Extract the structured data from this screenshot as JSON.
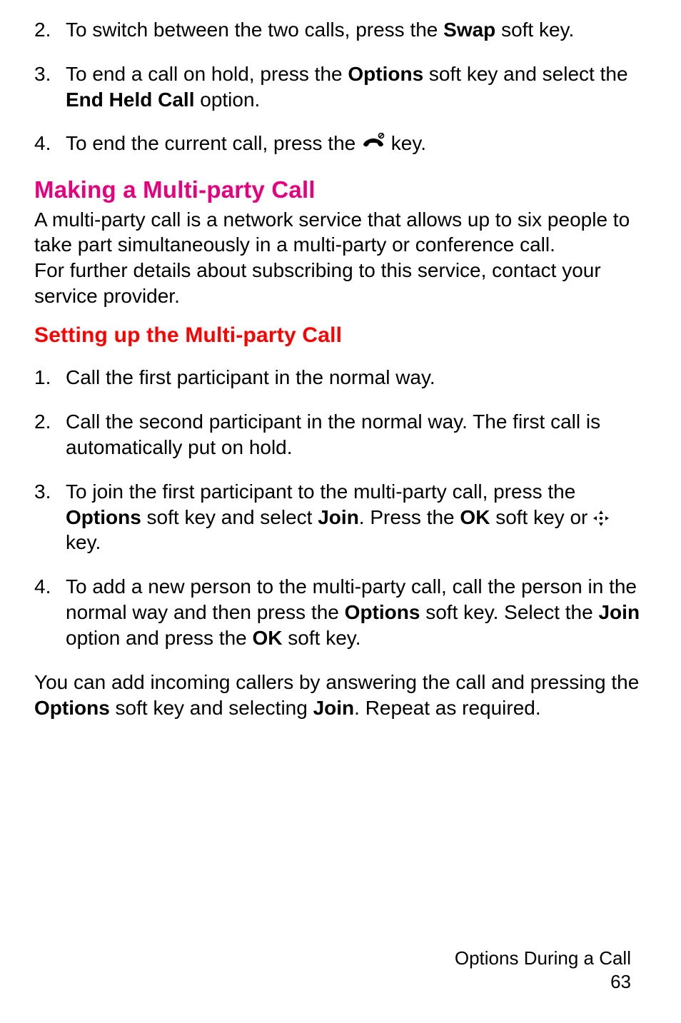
{
  "list1": [
    {
      "num": "2.",
      "text_a": "To switch between the two calls, press the ",
      "bold_a": "Swap",
      "text_b": " soft key."
    },
    {
      "num": "3.",
      "text_a": "To end a call on hold, press the ",
      "bold_a": "Options",
      "text_b": " soft key and select the ",
      "bold_b": "End Held Call",
      "text_c": " option."
    },
    {
      "num": "4.",
      "text_a": "To end the current call, press the ",
      "text_b": " key."
    }
  ],
  "section_heading": "Making a Multi-party Call",
  "section_para1": "A multi-party call is a network service that allows up to six people to take part simultaneously in a multi-party or conference call.",
  "section_para2": "For further details about subscribing to this service, contact your service provider.",
  "sub_heading": "Setting up the Multi-party Call",
  "list2": [
    {
      "num": "1.",
      "text_a": "Call the first participant in the normal way."
    },
    {
      "num": "2.",
      "text_a": "Call the second participant in the normal way. The first call is automatically put on hold."
    },
    {
      "num": "3.",
      "text_a": "To join the first participant to the multi-party call, press the ",
      "bold_a": "Options",
      "text_b": " soft key and select ",
      "bold_b": "Join",
      "text_c": ". Press the ",
      "bold_c": "OK",
      "text_d": " soft key or ",
      "text_e": " key."
    },
    {
      "num": "4.",
      "text_a": "To add a new person to the multi-party call, call the person in the normal way and then press the ",
      "bold_a": "Options",
      "text_b": " soft key. Select the ",
      "bold_b": "Join",
      "text_c": " option and press the ",
      "bold_c": "OK",
      "text_d": " soft key."
    }
  ],
  "closing_a": "You can add incoming callers by answering the call and pressing the ",
  "closing_bold_a": "Options",
  "closing_b": " soft key and selecting ",
  "closing_bold_b": "Join",
  "closing_c": ". Repeat as required.",
  "footer_title": "Options During a Call",
  "footer_page": "63",
  "icons": {
    "end_call": "end-call-icon",
    "nav": "navigation-icon"
  }
}
